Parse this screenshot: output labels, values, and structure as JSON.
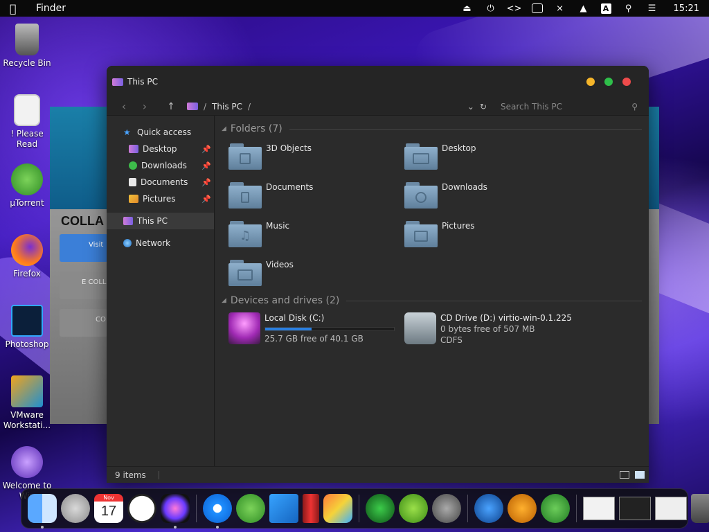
{
  "menubar": {
    "app_name": "Finder",
    "time": "15:21",
    "input_badge": "A"
  },
  "desktop_icons": [
    {
      "label": "Recycle Bin"
    },
    {
      "label": "! Please Read"
    },
    {
      "label": "µTorrent"
    },
    {
      "label": "Firefox"
    },
    {
      "label": "Photoshop"
    },
    {
      "label": "VMware Workstati..."
    },
    {
      "label": "Welcome to Win"
    }
  ],
  "background_window": {
    "heading": "COLLA",
    "button1": "Visit",
    "button2": "E COLL",
    "button3": "CO"
  },
  "window": {
    "title": "This PC",
    "breadcrumb": "This PC",
    "breadcrumb_sep": "/",
    "search_placeholder": "Search This PC",
    "sidebar": {
      "quick_access": "Quick access",
      "items": [
        {
          "label": "Desktop"
        },
        {
          "label": "Downloads"
        },
        {
          "label": "Documents"
        },
        {
          "label": "Pictures"
        }
      ],
      "this_pc": "This PC",
      "network": "Network"
    },
    "folders_header": "Folders (7)",
    "folders": [
      {
        "name": "3D Objects"
      },
      {
        "name": "Desktop"
      },
      {
        "name": "Documents"
      },
      {
        "name": "Downloads"
      },
      {
        "name": "Music"
      },
      {
        "name": "Pictures"
      },
      {
        "name": "Videos"
      }
    ],
    "drives_header": "Devices and drives (2)",
    "drives": [
      {
        "name": "Local Disk (C:)",
        "free": "25.7 GB free of 40.1 GB",
        "used_fraction": 0.36
      },
      {
        "name": "CD Drive (D:) virtio-win-0.1.225",
        "free": "0 bytes free of 507 MB",
        "fs": "CDFS"
      }
    ],
    "status": "9 items"
  },
  "dock": {
    "calendar_month": "Nov",
    "calendar_day": "17"
  },
  "colors": {
    "accent": "#2a7fe0",
    "close": "#ee4b4b",
    "minimize": "#f5b52a",
    "maximize": "#2fbf4a"
  }
}
